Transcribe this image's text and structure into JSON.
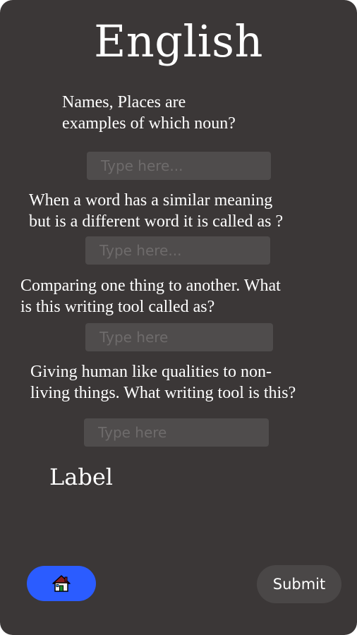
{
  "page": {
    "title": "English"
  },
  "questions": [
    {
      "line1": "Names, Places are",
      "line2": "examples of which noun?",
      "placeholder": "Type here..."
    },
    {
      "line1": "When a word has a similar meaning",
      "line2": "but is a different word it is called as ?",
      "placeholder": "Type here..."
    },
    {
      "line1": "Comparing one thing to another. What",
      "line2": "is this writing tool called as?",
      "placeholder": "Type here"
    },
    {
      "line1": "Giving human like qualities to non-",
      "line2": "living things. What writing tool is this?",
      "placeholder": "Type here"
    }
  ],
  "result_label": "Label",
  "footer": {
    "home_icon": "house-icon",
    "home_color": "#2b5cff",
    "submit_label": "Submit"
  },
  "colors": {
    "background": "#3b3737",
    "input_background": "#4f4c4c",
    "text": "#ffffff"
  }
}
